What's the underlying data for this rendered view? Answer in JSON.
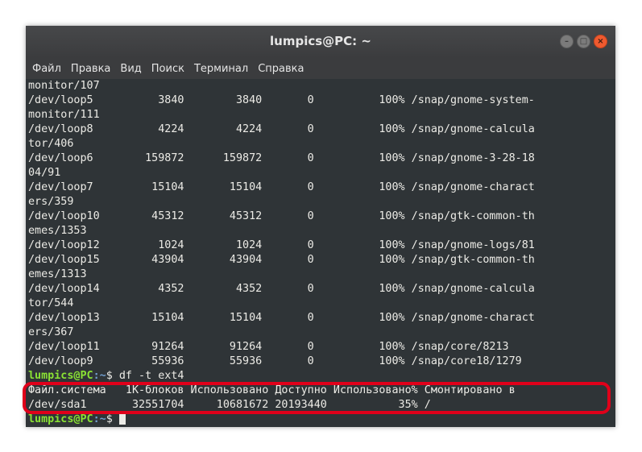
{
  "window": {
    "title": "lumpics@PC: ~",
    "controls": {
      "minimize": "–",
      "maximize": "□",
      "close": "×"
    }
  },
  "menu": [
    "Файл",
    "Правка",
    "Вид",
    "Поиск",
    "Терминал",
    "Справка"
  ],
  "terminal": {
    "lines": [
      "monitor/107",
      "/dev/loop5          3840        3840       0          100% /snap/gnome-system-",
      "monitor/111",
      "/dev/loop8          4224        4224       0          100% /snap/gnome-calcula",
      "tor/406",
      "/dev/loop6        159872      159872       0          100% /snap/gnome-3-28-18",
      "04/91",
      "/dev/loop7         15104       15104       0          100% /snap/gnome-charact",
      "ers/359",
      "/dev/loop10        45312       45312       0          100% /snap/gtk-common-th",
      "emes/1353",
      "/dev/loop12         1024        1024       0          100% /snap/gnome-logs/81",
      "/dev/loop15        43904       43904       0          100% /snap/gtk-common-th",
      "emes/1313",
      "/dev/loop14         4352        4352       0          100% /snap/gnome-calcula",
      "tor/544",
      "/dev/loop13        15104       15104       0          100% /snap/gnome-charact",
      "ers/367",
      "/dev/loop11        91264       91264       0          100% /snap/core/8213",
      "/dev/loop9         55936       55936       0          100% /snap/core18/1279"
    ],
    "prompt1": {
      "user": "lumpics@PC",
      "path": ":~",
      "symbol": "$ ",
      "command": "df -t ext4"
    },
    "result_header": "Файл.система   1K-блоков Использовано Доступно Использовано% Смонтировано в",
    "result_row": "/dev/sda1       32551704     10681672 20193440           35% /",
    "prompt2": {
      "user": "lumpics@PC",
      "path": ":~",
      "symbol": "$ "
    }
  },
  "colors": {
    "background": "#2f3437",
    "text": "#ecebe6",
    "prompt_user": "#8ae234",
    "prompt_path": "#729fcf",
    "highlight": "#e0001a",
    "close_button": "#ef5a2f"
  }
}
